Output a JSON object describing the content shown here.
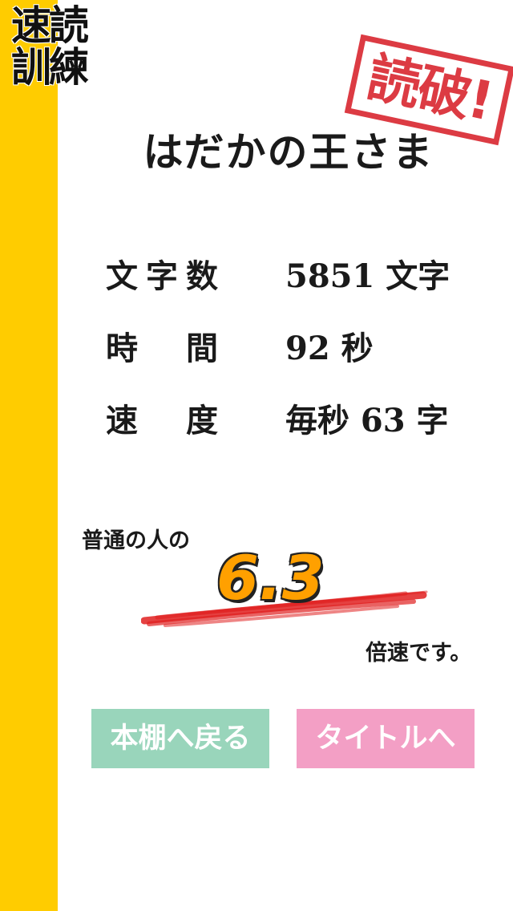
{
  "logo": {
    "line1": "速読",
    "line2": "訓練"
  },
  "stamp": {
    "text": "読破!",
    "color": "#d8202a"
  },
  "book_title": "はだかの王さま",
  "stats": [
    {
      "label": "文字数",
      "value": "5851 文字"
    },
    {
      "label": "時間",
      "value": "92 秒"
    },
    {
      "label": "速度",
      "value": "毎秒 63 字"
    }
  ],
  "comparison": {
    "prefix": "普通の人の",
    "multiplier": "6.3",
    "suffix": "倍速です。"
  },
  "buttons": {
    "bookshelf": "本棚へ戻る",
    "title": "タイトルへ"
  },
  "colors": {
    "sidebar": "#ffcc00",
    "bookshelf_button": "#99d5bb",
    "title_button": "#f39fc5",
    "multiplier": "#ffa000",
    "underline": "#e02020"
  }
}
